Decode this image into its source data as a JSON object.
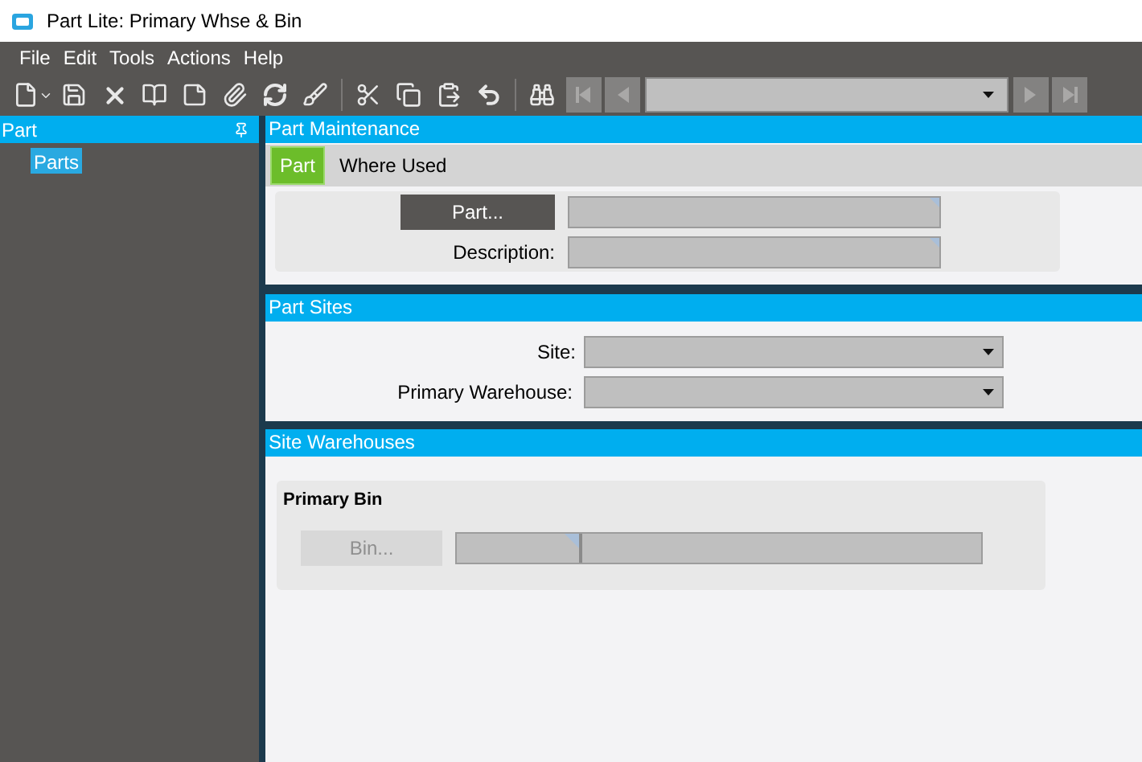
{
  "window": {
    "title": "Part Lite: Primary Whse & Bin"
  },
  "menu": [
    "File",
    "Edit",
    "Tools",
    "Actions",
    "Help"
  ],
  "tree_panel": {
    "title": "Part",
    "items": [
      {
        "label": "Parts",
        "selected": true
      }
    ]
  },
  "main_panel": {
    "title": "Part Maintenance",
    "tabs": [
      {
        "label": "Part",
        "selected": true
      },
      {
        "label": "Where Used",
        "selected": false
      }
    ],
    "part_button": "Part...",
    "description_label": "Description:"
  },
  "part_sites": {
    "title": "Part Sites",
    "site_label": "Site:",
    "warehouse_label": "Primary Warehouse:"
  },
  "site_warehouses": {
    "title": "Site Warehouses",
    "group_title": "Primary Bin",
    "bin_button": {
      "label": "Bin...",
      "disabled": true
    }
  }
}
